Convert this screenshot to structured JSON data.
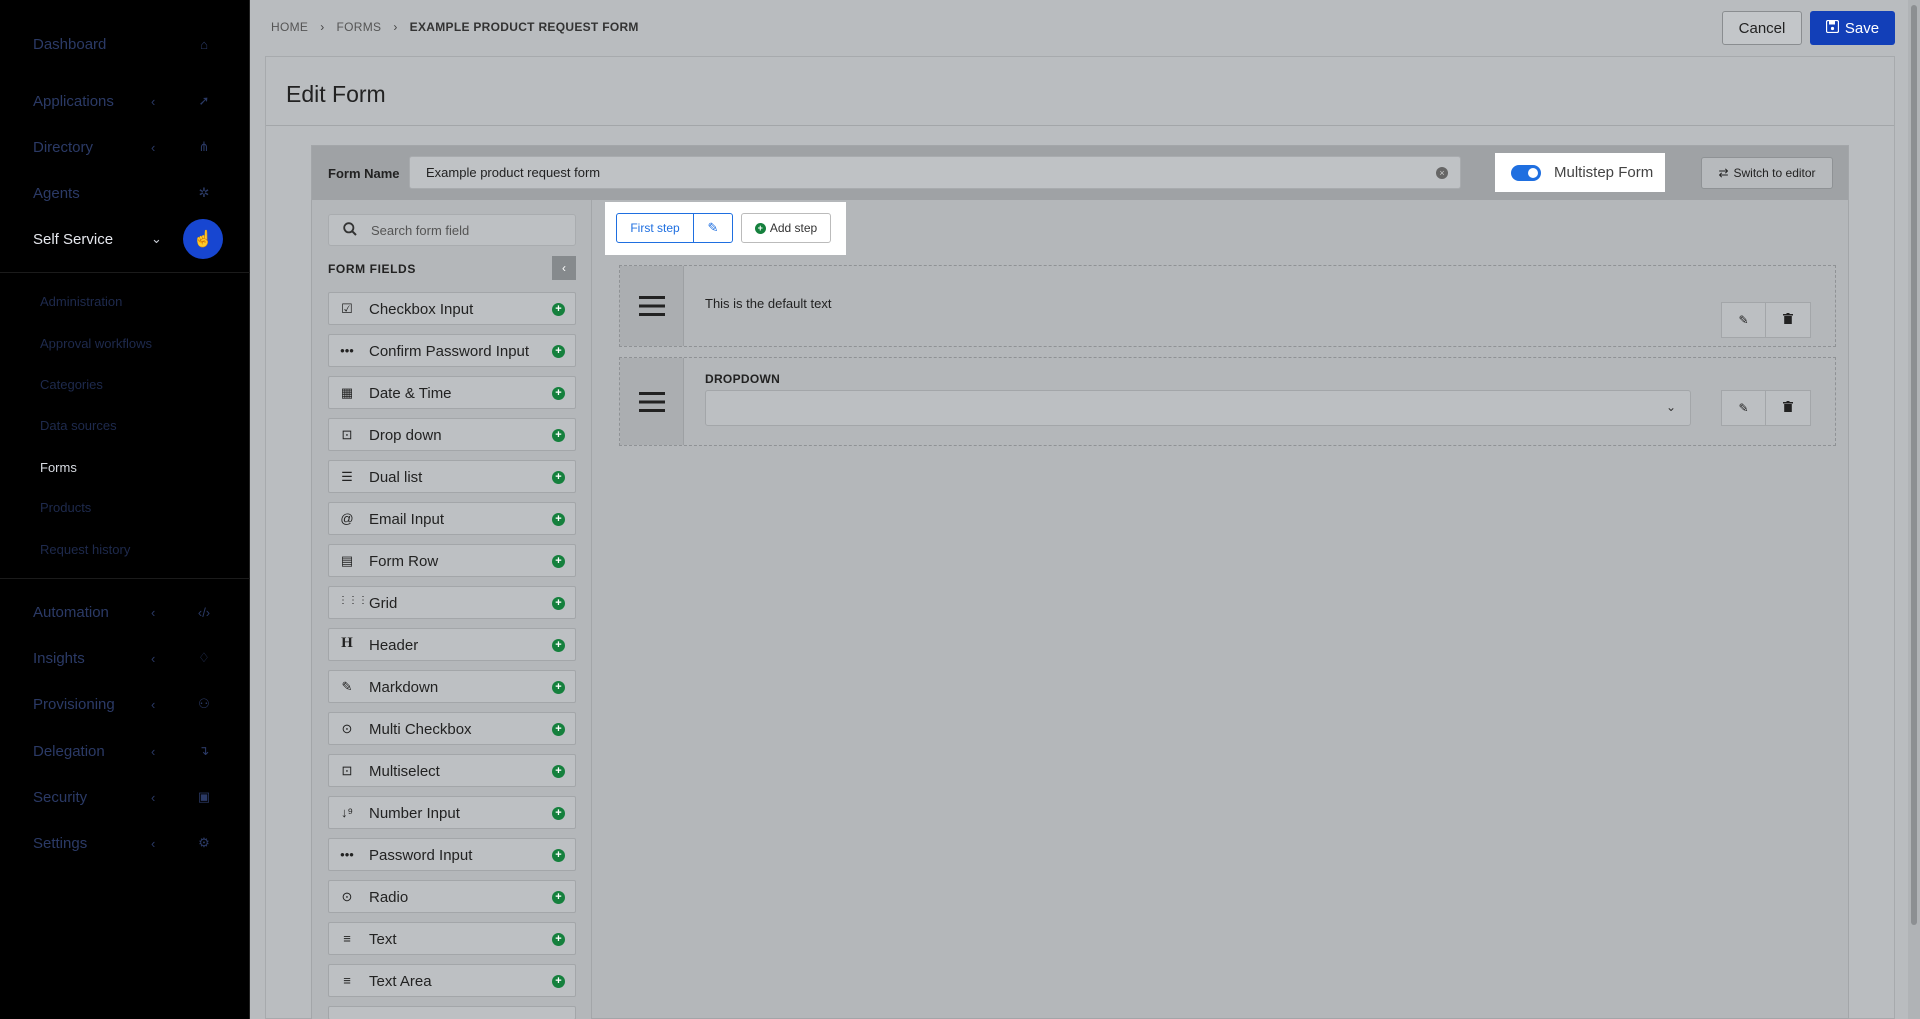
{
  "sidebar": {
    "items": [
      {
        "label": "Dashboard",
        "icon": "home-icon",
        "glyph": "⌂",
        "chevron": ""
      },
      {
        "label": "Applications",
        "icon": "rocket-icon",
        "glyph": "➚",
        "chevron": "‹"
      },
      {
        "label": "Directory",
        "icon": "sitemap-icon",
        "glyph": "⋔",
        "chevron": "‹"
      },
      {
        "label": "Agents",
        "icon": "agents-icon",
        "glyph": "✲",
        "chevron": ""
      },
      {
        "label": "Self Service",
        "icon": "hand-pointer-icon",
        "glyph": "☝",
        "chevron": "⌄"
      }
    ],
    "sub_items": [
      "Administration",
      "Approval workflows",
      "Categories",
      "Data sources",
      "Forms",
      "Products",
      "Request history"
    ],
    "bottom_items": [
      {
        "label": "Automation",
        "icon": "code-icon",
        "glyph": "‹/›",
        "chevron": "‹"
      },
      {
        "label": "Insights",
        "icon": "lightbulb-icon",
        "glyph": "♢",
        "chevron": "‹"
      },
      {
        "label": "Provisioning",
        "icon": "users-icon",
        "glyph": "⚇",
        "chevron": "‹"
      },
      {
        "label": "Delegation",
        "icon": "arrow-turn-icon",
        "glyph": "↴",
        "chevron": "‹"
      },
      {
        "label": "Security",
        "icon": "lock-icon",
        "glyph": "▣",
        "chevron": "‹"
      },
      {
        "label": "Settings",
        "icon": "gear-icon",
        "glyph": "⚙",
        "chevron": "‹"
      }
    ]
  },
  "breadcrumb": [
    "HOME",
    "FORMS",
    "EXAMPLE PRODUCT REQUEST FORM"
  ],
  "actions": {
    "cancel": "Cancel",
    "save": "Save"
  },
  "page": {
    "title": "Edit Form"
  },
  "form": {
    "name_label": "Form Name",
    "name_value": "Example product request form",
    "multistep_label": "Multistep Form",
    "switch_label": "Switch to editor"
  },
  "fields_panel": {
    "search_placeholder": "Search form field",
    "title": "FORM FIELDS",
    "items": [
      {
        "label": "Checkbox Input",
        "icon": "checkbox-icon",
        "glyph": "☑"
      },
      {
        "label": "Confirm Password Input",
        "icon": "password-dots-icon",
        "glyph": "•••"
      },
      {
        "label": "Date & Time",
        "icon": "calendar-icon",
        "glyph": "▦"
      },
      {
        "label": "Drop down",
        "icon": "dropdown-icon",
        "glyph": "⊡"
      },
      {
        "label": "Dual list",
        "icon": "dual-list-icon",
        "glyph": "☰"
      },
      {
        "label": "Email Input",
        "icon": "at-icon",
        "glyph": "@"
      },
      {
        "label": "Form Row",
        "icon": "table-icon",
        "glyph": "▤"
      },
      {
        "label": "Grid",
        "icon": "grid-icon",
        "glyph": "⋮⋮⋮"
      },
      {
        "label": "Header",
        "icon": "heading-icon",
        "glyph": "H"
      },
      {
        "label": "Markdown",
        "icon": "edit-icon",
        "glyph": "✎"
      },
      {
        "label": "Multi Checkbox",
        "icon": "check-circle-icon",
        "glyph": "⊙"
      },
      {
        "label": "Multiselect",
        "icon": "multiselect-icon",
        "glyph": "⊡"
      },
      {
        "label": "Number Input",
        "icon": "number-sort-icon",
        "glyph": "↓⁹"
      },
      {
        "label": "Password Input",
        "icon": "password-dots-icon",
        "glyph": "•••"
      },
      {
        "label": "Radio",
        "icon": "radio-icon",
        "glyph": "⊙"
      },
      {
        "label": "Text",
        "icon": "align-left-icon",
        "glyph": "≡"
      },
      {
        "label": "Text Area",
        "icon": "align-left-icon",
        "glyph": "≡"
      }
    ]
  },
  "steps": {
    "first": "First step",
    "add": "Add step"
  },
  "canvas": {
    "text_block": "This is the default text",
    "dropdown_label": "DROPDOWN"
  }
}
